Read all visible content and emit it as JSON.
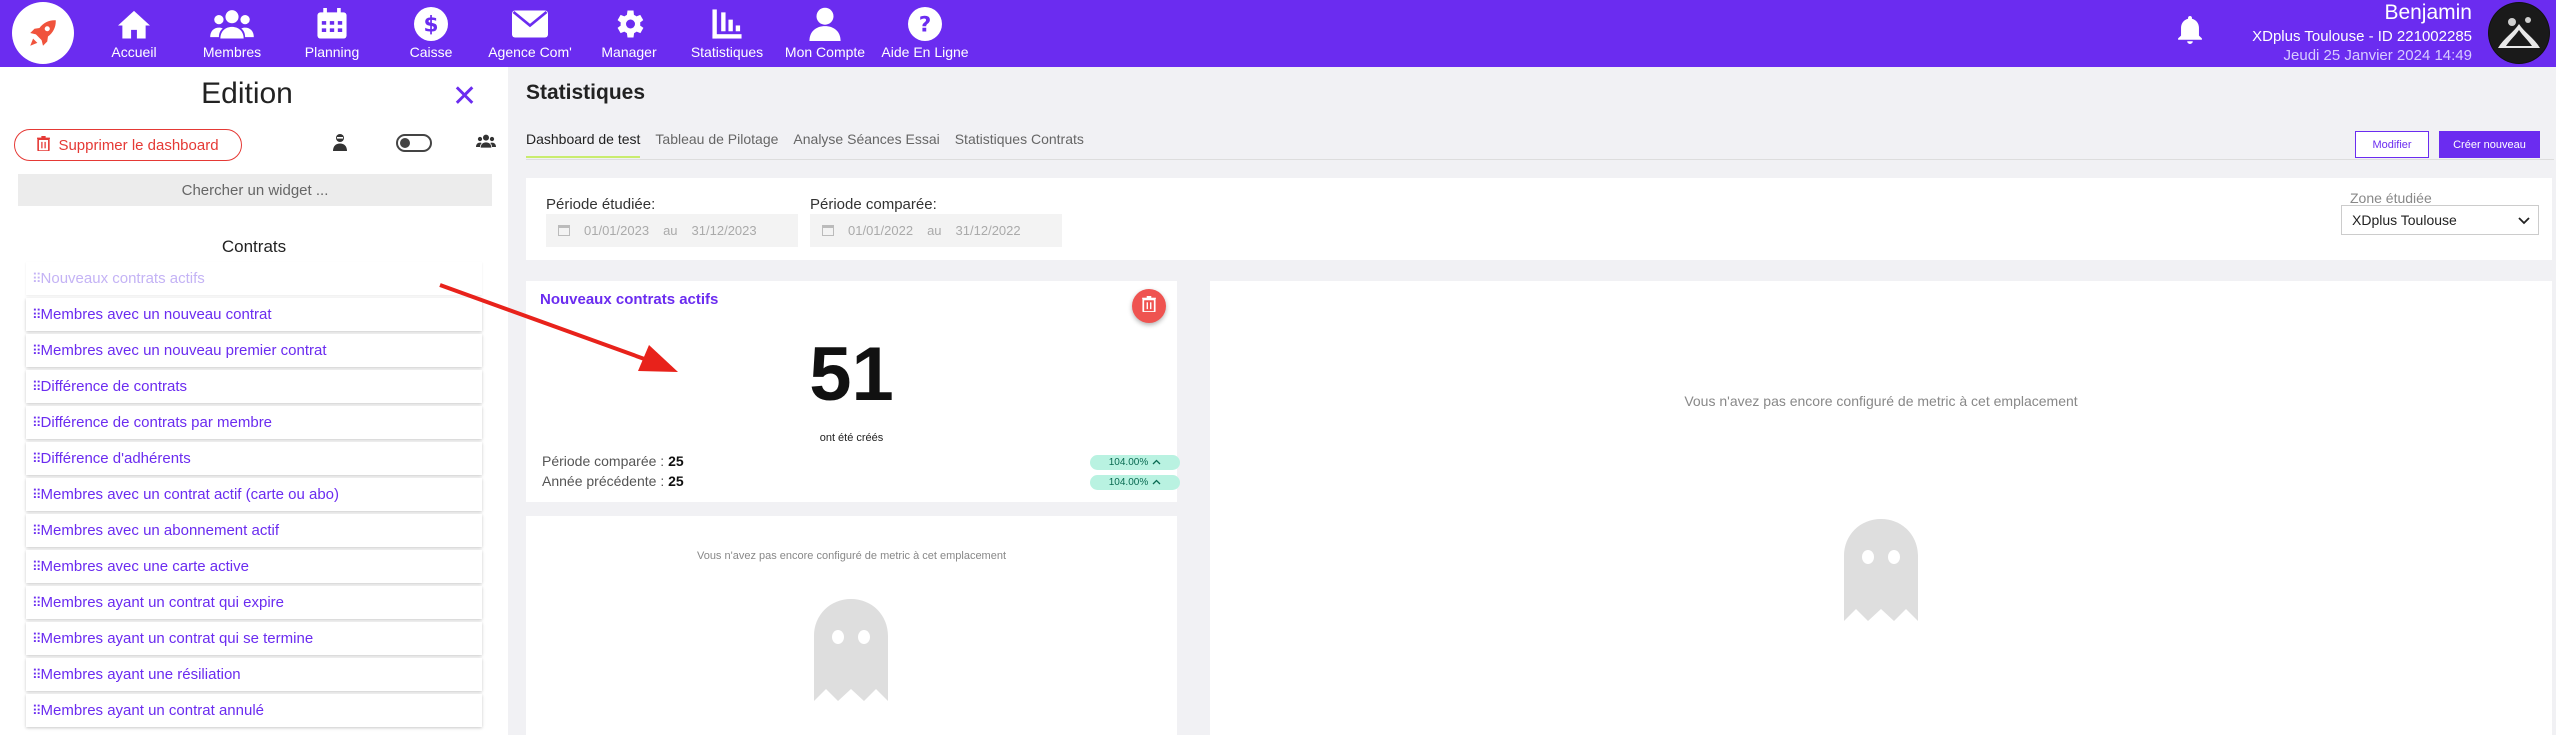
{
  "nav": {
    "items": [
      {
        "label": "Accueil",
        "icon": "home-icon"
      },
      {
        "label": "Membres",
        "icon": "users-icon"
      },
      {
        "label": "Planning",
        "icon": "calendar-icon"
      },
      {
        "label": "Caisse",
        "icon": "dollar-icon"
      },
      {
        "label": "Agence Com'",
        "icon": "envelope-icon"
      },
      {
        "label": "Manager",
        "icon": "gear-icon"
      },
      {
        "label": "Statistiques",
        "icon": "chart-icon"
      },
      {
        "label": "Mon Compte",
        "icon": "user-icon"
      },
      {
        "label": "Aide En Ligne",
        "icon": "help-icon"
      }
    ]
  },
  "user": {
    "name": "Benjamin",
    "club": "XDplus Toulouse - ID 221002285",
    "date": "Jeudi 25 Janvier 2024 14:49"
  },
  "edition": {
    "title": "Edition",
    "delete_label": "Supprimer le dashboard",
    "search_placeholder": "Chercher un widget ...",
    "section_title": "Contrats",
    "widgets": [
      "Nouveaux contrats actifs",
      "Membres avec un nouveau contrat",
      "Membres avec un nouveau premier contrat",
      "Différence de contrats",
      "Différence de contrats par membre",
      "Différence d'adhérents",
      "Membres avec un contrat actif (carte ou abo)",
      "Membres avec un abonnement actif",
      "Membres avec une carte active",
      "Membres ayant un contrat qui expire",
      "Membres ayant un contrat qui se termine",
      "Membres ayant une résiliation",
      "Membres ayant un contrat annulé"
    ]
  },
  "main": {
    "title": "Statistiques",
    "tabs": [
      "Dashboard de test",
      "Tableau de Pilotage",
      "Analyse Séances Essai",
      "Statistiques Contrats"
    ],
    "modifier_label": "Modifier",
    "creer_label": "Créer nouveau",
    "filters": {
      "periode_etudiee_label": "Période étudiée:",
      "periode_etudiee_from": "01/01/2023",
      "periode_etudiee_to": "31/12/2023",
      "periode_comparee_label": "Période comparée:",
      "periode_comparee_from": "01/01/2022",
      "periode_comparee_to": "31/12/2022",
      "au": "au",
      "zone_label": "Zone étudiée",
      "zone_value": "XDplus Toulouse"
    },
    "widget1": {
      "title": "Nouveaux contrats actifs",
      "value": "51",
      "subtitle": "ont été créés",
      "compared_label": "Période comparée : ",
      "compared_value": "25",
      "compared_badge": "104.00%",
      "previous_label": "Année précédente : ",
      "previous_value": "25",
      "previous_badge": "104.00%"
    },
    "empty_text": "Vous n'avez pas encore configuré de metric à cet emplacement"
  }
}
